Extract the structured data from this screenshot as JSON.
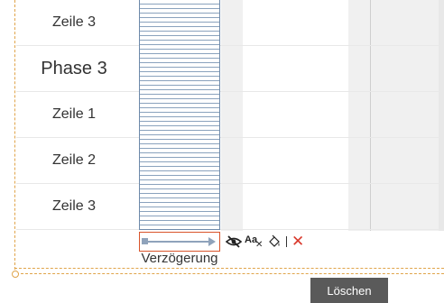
{
  "rows": [
    {
      "label": "Zeile 3",
      "type": "row"
    },
    {
      "label": "Phase 3",
      "type": "phase"
    },
    {
      "label": "Zeile 1",
      "type": "row"
    },
    {
      "label": "Zeile 2",
      "type": "row"
    },
    {
      "label": "Zeile 3",
      "type": "row"
    }
  ],
  "delay_bar": {
    "label": "Verzögerung",
    "fill_color": "#8aa2bd",
    "border_color": "#6e8aaa"
  },
  "selection": {
    "border_color": "#d9542b"
  },
  "toolbar": {
    "items": [
      {
        "icon": "hide-eye-icon"
      },
      {
        "icon": "text-format-icon",
        "text": "Aa",
        "sub": "✕"
      },
      {
        "icon": "paint-bucket-icon"
      },
      {
        "icon": "separator"
      },
      {
        "icon": "delete-icon",
        "glyph": "✕"
      }
    ]
  },
  "tooltip": {
    "text": "Löschen"
  },
  "colors": {
    "guide": "#e0a44a",
    "delete": "#d9382b",
    "tooltip_bg": "#5a5a5a"
  }
}
